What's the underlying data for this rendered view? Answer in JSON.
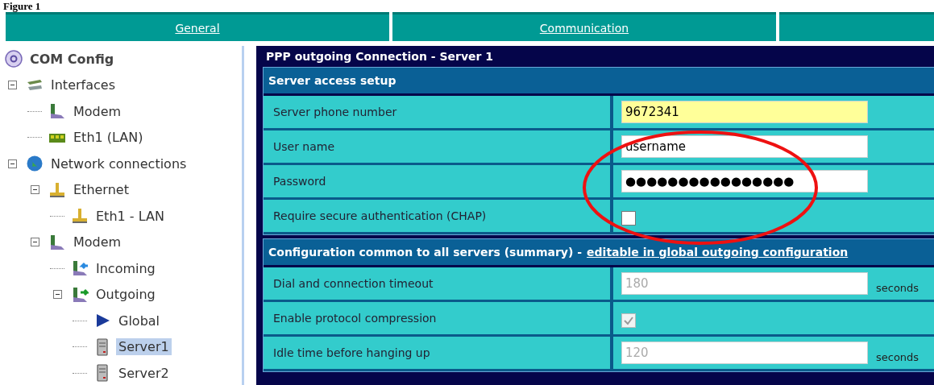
{
  "caption": "Figure 1",
  "tabs": [
    {
      "label": "General",
      "selected": false
    },
    {
      "label": "Communication",
      "selected": false
    },
    {
      "selected": false
    }
  ],
  "tree": [
    {
      "label": "COM Config",
      "kind": "root",
      "selected": false,
      "children": [
        {
          "label": "Interfaces",
          "kind": "interfaces",
          "expanded": true,
          "selected": false,
          "children": [
            {
              "label": "Modem",
              "kind": "modem",
              "selected": false
            },
            {
              "label": "Eth1 (LAN)",
              "kind": "lan-card",
              "selected": false
            }
          ]
        },
        {
          "label": "Network connections",
          "kind": "network",
          "expanded": true,
          "selected": false,
          "children": [
            {
              "label": "Ethernet",
              "kind": "ethernet",
              "expanded": true,
              "selected": false,
              "children": [
                {
                  "label": "Eth1 - LAN",
                  "kind": "ethernet",
                  "selected": false
                }
              ]
            },
            {
              "label": "Modem",
              "kind": "modem",
              "expanded": true,
              "selected": false,
              "children": [
                {
                  "label": "Incoming",
                  "kind": "incoming",
                  "selected": false
                },
                {
                  "label": "Outgoing",
                  "kind": "outgoing",
                  "expanded": true,
                  "selected": false,
                  "children": [
                    {
                      "label": "Global",
                      "kind": "global",
                      "selected": false
                    },
                    {
                      "label": "Server1",
                      "kind": "server",
                      "selected": true
                    },
                    {
                      "label": "Server2",
                      "kind": "server",
                      "selected": false
                    }
                  ]
                }
              ]
            }
          ]
        }
      ]
    }
  ],
  "panel": {
    "title": "PPP outgoing Connection - Server 1",
    "sections": [
      {
        "title": "Server access setup",
        "rows": [
          {
            "label": "Server phone number",
            "kind": "text",
            "value": "9672341",
            "focused": true,
            "disabled": false
          },
          {
            "label": "User name",
            "kind": "text",
            "value": "username",
            "focused": false,
            "disabled": false
          },
          {
            "label": "Password",
            "kind": "text",
            "value": "●●●●●●●●●●●●●●●●",
            "focused": false,
            "disabled": false
          },
          {
            "label": "Require secure authentication (CHAP)",
            "kind": "checkbox",
            "checked": false,
            "disabled": false
          }
        ]
      },
      {
        "title": "Configuration common to all servers (summary) -",
        "link": "editable in global outgoing configuration",
        "rows": [
          {
            "label": "Dial and connection timeout",
            "kind": "text",
            "value": "180",
            "unit": "seconds",
            "focused": false,
            "disabled": true
          },
          {
            "label": "Enable protocol compression",
            "kind": "checkbox",
            "checked": true,
            "disabled": true
          },
          {
            "label": "Idle time before hanging up",
            "kind": "text",
            "value": "120",
            "unit": "seconds",
            "focused": false,
            "disabled": true
          }
        ]
      }
    ]
  },
  "highlight_ellipse": true
}
